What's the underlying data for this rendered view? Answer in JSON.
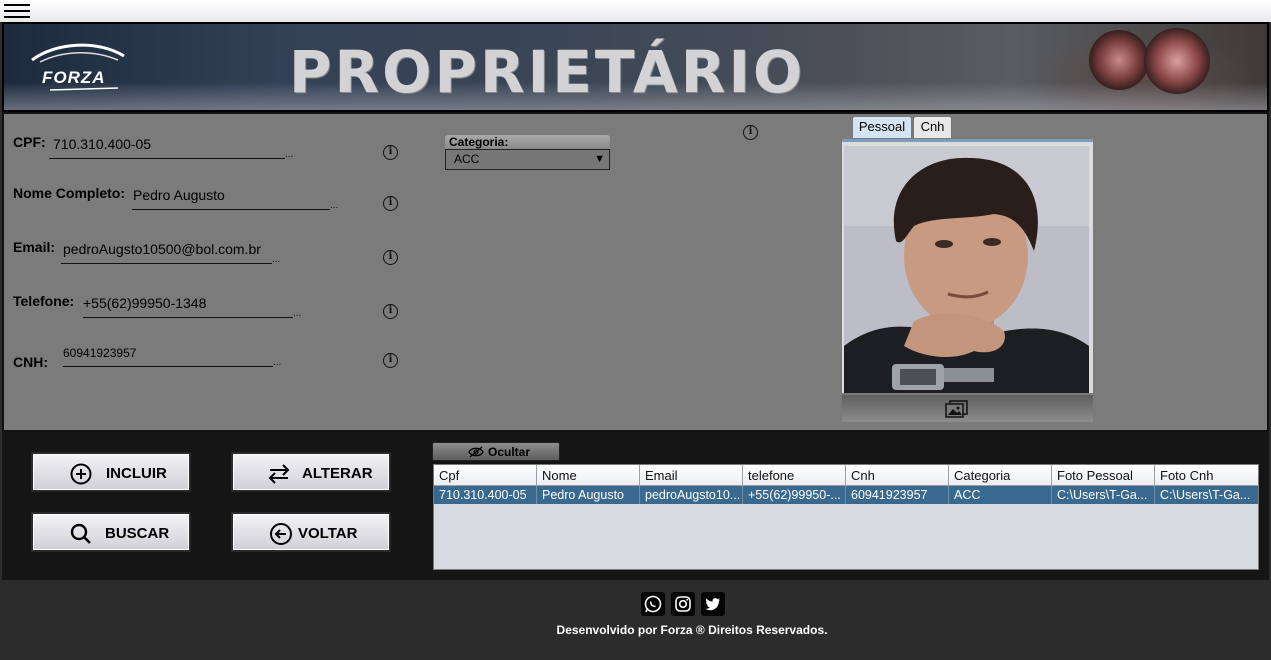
{
  "menu_icon": "hamburger-icon",
  "banner": {
    "logo_text": "FORZA",
    "title": "PROPRIETÁRIO"
  },
  "form": {
    "cpf_label": "CPF:",
    "cpf_value": "710.310.400-05",
    "nome_label": "Nome Completo:",
    "nome_value": "Pedro Augusto",
    "email_label": "Email:",
    "email_value": "pedroAugsto10500@bol.com.br",
    "telefone_label": "Telefone:",
    "telefone_value": "+55(62)99950-1348",
    "cnh_label": "CNH:",
    "cnh_value": "60941923957",
    "dots": "...",
    "info_glyph": "i",
    "categoria_label": "Categoria:",
    "categoria_value": "ACC",
    "categoria_arrow": "▼"
  },
  "photo": {
    "tabs": [
      {
        "label": "Pessoal",
        "active": true
      },
      {
        "label": "Cnh",
        "active": false
      }
    ],
    "change_icon": "images-icon"
  },
  "actions": {
    "incluir": "INCLUIR",
    "alterar": "ALTERAR",
    "buscar": "BUSCAR",
    "voltar": "VOLTAR"
  },
  "table": {
    "toggle_label": "Ocultar",
    "columns": [
      "Cpf",
      "Nome",
      "Email",
      "telefone",
      "Cnh",
      "Categoria",
      "Foto Pessoal",
      "Foto Cnh"
    ],
    "rows": [
      [
        "710.310.400-05",
        "Pedro Augusto",
        "pedroAugsto10...",
        "+55(62)99950-...",
        "60941923957",
        "ACC",
        "C:\\Users\\T-Ga...",
        "C:\\Users\\T-Ga..."
      ]
    ]
  },
  "footer": {
    "social_icons": [
      "whatsapp-icon",
      "instagram-icon",
      "twitter-icon"
    ],
    "text": "Desenvolvido por Forza ® Direitos Reservados."
  },
  "colors": {
    "form_bg": "#7b7b7b",
    "selected_row": "#39698f",
    "active_tab": "#d5e4f2"
  }
}
